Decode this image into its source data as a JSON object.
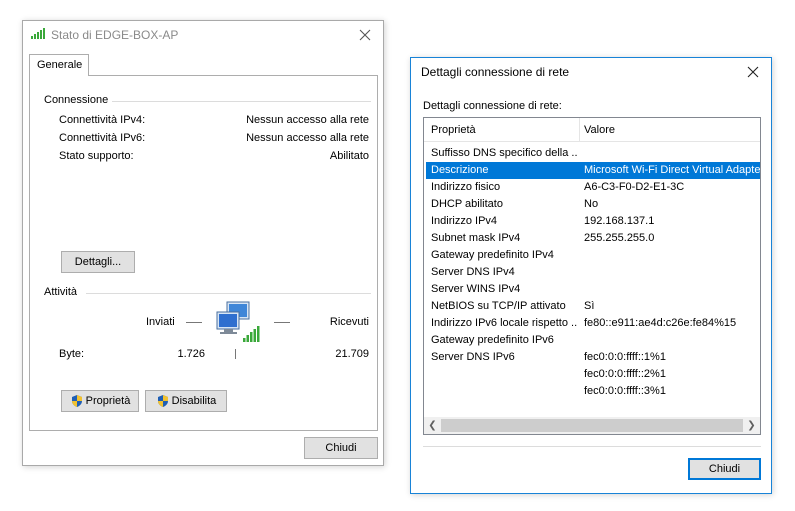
{
  "win1": {
    "title": "Stato di EDGE-BOX-AP",
    "tab": "Generale",
    "connection": {
      "label": "Connessione",
      "rows": [
        {
          "label": "Connettività IPv4:",
          "value": "Nessun accesso alla rete"
        },
        {
          "label": "Connettività IPv6:",
          "value": "Nessun accesso alla rete"
        },
        {
          "label": "Stato supporto:",
          "value": "Abilitato"
        }
      ],
      "details_button": "Dettagli..."
    },
    "activity": {
      "label": "Attività",
      "sent_label": "Inviati",
      "received_label": "Ricevuti",
      "bytes_label": "Byte:",
      "bytes_sent": "1.726",
      "bytes_received": "21.709"
    },
    "properties_button": "Proprietà",
    "disable_button": "Disabilita",
    "close_button": "Chiudi"
  },
  "win2": {
    "title": "Dettagli connessione di rete",
    "subtitle": "Dettagli connessione di rete:",
    "columns": [
      "Proprietà",
      "Valore"
    ],
    "rows": [
      {
        "prop": "Suffisso DNS specifico della ...",
        "value": ""
      },
      {
        "prop": "Descrizione",
        "value": "Microsoft Wi-Fi Direct Virtual Adapter",
        "selected": true
      },
      {
        "prop": "Indirizzo fisico",
        "value": "A6-C3-F0-D2-E1-3C"
      },
      {
        "prop": "DHCP abilitato",
        "value": "No"
      },
      {
        "prop": "Indirizzo IPv4",
        "value": "192.168.137.1"
      },
      {
        "prop": "Subnet mask IPv4",
        "value": "255.255.255.0"
      },
      {
        "prop": "Gateway predefinito IPv4",
        "value": ""
      },
      {
        "prop": "Server DNS IPv4",
        "value": ""
      },
      {
        "prop": "Server WINS IPv4",
        "value": ""
      },
      {
        "prop": "NetBIOS su TCP/IP attivato",
        "value": "Sì"
      },
      {
        "prop": "Indirizzo IPv6 locale rispetto ...",
        "value": "fe80::e911:ae4d:c26e:fe84%15"
      },
      {
        "prop": "Gateway predefinito IPv6",
        "value": ""
      },
      {
        "prop": "Server DNS IPv6",
        "value": "fec0:0:0:ffff::1%1"
      },
      {
        "prop": "",
        "value": "fec0:0:0:ffff::2%1"
      },
      {
        "prop": "",
        "value": "fec0:0:0:ffff::3%1"
      }
    ],
    "close_button": "Chiudi"
  },
  "colors": {
    "accent": "#0078d7",
    "signal_green": "#3aa83a",
    "button_bg": "#e1e1e1"
  }
}
